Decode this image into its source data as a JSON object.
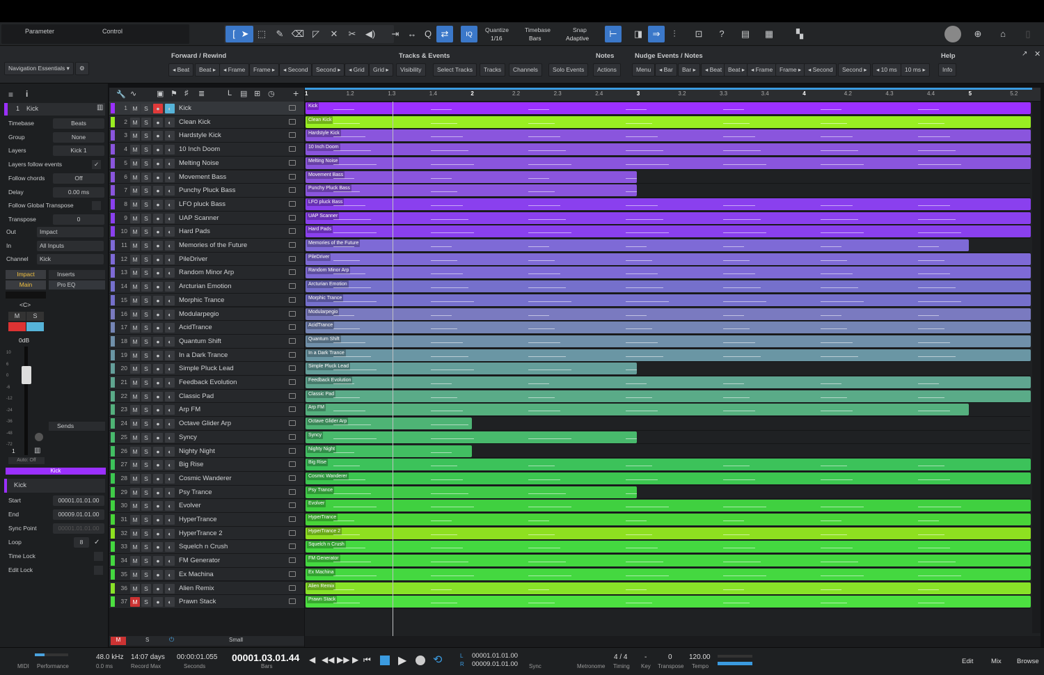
{
  "toolbar": {
    "parameter": "Parameter",
    "control": "Control",
    "quantize_label": "Quantize",
    "quantize_value": "1/16",
    "timebase_label": "Timebase",
    "timebase_value": "Bars",
    "snap_label": "Snap",
    "snap_value": "Adaptive",
    "iq": "IQ"
  },
  "macro": {
    "nav_essentials": "Navigation Essentials",
    "groups": [
      {
        "title": "Forward / Rewind",
        "buttons": [
          "◂ Beat",
          "Beat ▸",
          "◂ Frame",
          "Frame ▸",
          "◂ Second",
          "Second ▸",
          "◂ Grid",
          "Grid ▸"
        ]
      },
      {
        "title": "Tracks & Events",
        "buttons": [
          "Visibility",
          "Select Tracks",
          "Tracks",
          "Channels",
          "Solo Events"
        ]
      },
      {
        "title": "Notes",
        "buttons": [
          "Actions"
        ]
      },
      {
        "title": "Nudge Events / Notes",
        "buttons": [
          "Menu",
          "◂ Bar",
          "Bar ▸",
          "◂ Beat",
          "Beat ▸",
          "◂ Frame",
          "Frame ▸",
          "◂ Second",
          "Second ▸",
          "◂ 10 ms",
          "10 ms ▸"
        ]
      },
      {
        "title": "Help",
        "buttons": [
          "Info"
        ]
      }
    ]
  },
  "inspector": {
    "track_number": "1",
    "track_name": "Kick",
    "rows": [
      {
        "label": "Timebase",
        "value": "Beats"
      },
      {
        "label": "Group",
        "value": "None"
      },
      {
        "label": "Layers",
        "value": "Kick 1"
      },
      {
        "label": "Layers follow events",
        "value": ""
      },
      {
        "label": "Follow chords",
        "value": "Off"
      },
      {
        "label": "Delay",
        "value": "0.00 ms"
      },
      {
        "label": "Follow Global Transpose",
        "value": ""
      },
      {
        "label": "Transpose",
        "value": "0"
      }
    ],
    "io": [
      {
        "label": "Out",
        "value": "Impact"
      },
      {
        "label": "In",
        "value": "All Inputs"
      },
      {
        "label": "Channel",
        "value": "Kick"
      }
    ],
    "channel": {
      "impact": "Impact",
      "main": "Main",
      "inserts": "Inserts",
      "pro_eq": "Pro EQ",
      "pan": "<C>",
      "mute": "M",
      "solo": "S",
      "volume": "0dB",
      "sends": "Sends",
      "auto": "Auto: Off",
      "channel_name": "Kick",
      "scale": [
        "10",
        "6",
        "0",
        "-6",
        "-12",
        "-24",
        "-36",
        "-48",
        "-72"
      ]
    },
    "event": {
      "name": "Kick",
      "start_label": "Start",
      "start": "00001.01.01.00",
      "end_label": "End",
      "end": "00009.01.01.00",
      "sync_label": "Sync Point",
      "sync": "00001.01.01.00",
      "loop_label": "Loop",
      "loop": "8",
      "timelock": "Time Lock",
      "editlock": "Edit Lock"
    }
  },
  "ruler": [
    "1",
    "1.2",
    "1.3",
    "1.4",
    "2",
    "2.2",
    "2.3",
    "2.4",
    "3",
    "3.2",
    "3.3",
    "3.4",
    "4",
    "4.2",
    "4.3",
    "4.4",
    "5",
    "5.2"
  ],
  "tracks": [
    {
      "n": "1",
      "name": "Kick",
      "color": "#9b30ff",
      "end": 1.0,
      "selected": true
    },
    {
      "n": "2",
      "name": "Clean Kick",
      "color": "#99ee22",
      "end": 1.0
    },
    {
      "n": "3",
      "name": "Hardstyle Kick",
      "color": "#8a55dd",
      "end": 1.0
    },
    {
      "n": "4",
      "name": "10 Inch Doom",
      "color": "#8a55dd",
      "end": 1.0
    },
    {
      "n": "5",
      "name": "Melting Noise",
      "color": "#8a55dd",
      "end": 1.0
    },
    {
      "n": "6",
      "name": "Movement Bass",
      "color": "#8a55dd",
      "end": 0.457
    },
    {
      "n": "7",
      "name": "Punchy Pluck Bass",
      "color": "#8a55dd",
      "end": 0.457
    },
    {
      "n": "8",
      "name": "LFO pluck Bass",
      "color": "#8a40ee",
      "end": 1.0
    },
    {
      "n": "9",
      "name": "UAP Scanner",
      "color": "#8a40ee",
      "end": 1.0
    },
    {
      "n": "10",
      "name": "Hard Pads",
      "color": "#8a40ee",
      "end": 1.0
    },
    {
      "n": "11",
      "name": "Memories of the Future",
      "color": "#7e6ad6",
      "end": 0.915
    },
    {
      "n": "12",
      "name": "PileDriver",
      "color": "#7e6ad6",
      "end": 1.0
    },
    {
      "n": "13",
      "name": "Random Minor Arp",
      "color": "#7e6ad6",
      "end": 1.0
    },
    {
      "n": "14",
      "name": "Arcturian Emotion",
      "color": "#7570cc",
      "end": 1.0
    },
    {
      "n": "15",
      "name": "Morphic Trance",
      "color": "#7570cc",
      "end": 1.0
    },
    {
      "n": "16",
      "name": "Modularpegio",
      "color": "#7a7ac0",
      "end": 1.0
    },
    {
      "n": "17",
      "name": "AcidTrance",
      "color": "#7585b5",
      "end": 1.0
    },
    {
      "n": "18",
      "name": "Quantum Shift",
      "color": "#7090aa",
      "end": 1.0
    },
    {
      "n": "19",
      "name": "In a Dark Trance",
      "color": "#6a96a4",
      "end": 1.0
    },
    {
      "n": "20",
      "name": "Simple Pluck Lead",
      "color": "#649e9a",
      "end": 0.457
    },
    {
      "n": "21",
      "name": "Feedback Evolution",
      "color": "#5fa590",
      "end": 1.0
    },
    {
      "n": "22",
      "name": "Classic Pad",
      "color": "#5aab88",
      "end": 1.0
    },
    {
      "n": "23",
      "name": "Arp FM",
      "color": "#55b07e",
      "end": 0.915
    },
    {
      "n": "24",
      "name": "Octave Glider Arp",
      "color": "#4eb475",
      "end": 0.229
    },
    {
      "n": "25",
      "name": "Syncy",
      "color": "#48b96c",
      "end": 0.457
    },
    {
      "n": "26",
      "name": "Nighty Night",
      "color": "#42be62",
      "end": 0.229
    },
    {
      "n": "27",
      "name": "Big Rise",
      "color": "#3cc25a",
      "end": 1.0
    },
    {
      "n": "28",
      "name": "Cosmic Wanderer",
      "color": "#3cc650",
      "end": 1.0
    },
    {
      "n": "29",
      "name": "Psy Trance",
      "color": "#40ca48",
      "end": 0.457
    },
    {
      "n": "30",
      "name": "Evolver",
      "color": "#40d040",
      "end": 1.0
    },
    {
      "n": "31",
      "name": "HyperTrance",
      "color": "#48d438",
      "end": 1.0
    },
    {
      "n": "32",
      "name": "HyperTrance 2",
      "color": "#8ee020",
      "end": 1.0
    },
    {
      "n": "33",
      "name": "Squelch n Crush",
      "color": "#44d840",
      "end": 1.0
    },
    {
      "n": "34",
      "name": "FM Generator",
      "color": "#44d840",
      "end": 1.0
    },
    {
      "n": "35",
      "name": "Ex Machina",
      "color": "#44d840",
      "end": 1.0
    },
    {
      "n": "36",
      "name": "Alien Remix",
      "color": "#88e228",
      "end": 1.0
    },
    {
      "n": "37",
      "name": "Prawn Stack",
      "color": "#4ce040",
      "end": 1.0,
      "mute_on": true
    }
  ],
  "tracklist_footer": {
    "m": "M",
    "s": "S",
    "size": "Small"
  },
  "transport": {
    "midi": "MIDI",
    "performance": "Performance",
    "sample_rate": "48.0 kHz",
    "latency": "0.0 ms",
    "record_days": "14:07 days",
    "record_max": "Record Max",
    "seconds_value": "00:00:01.055",
    "seconds_label": "Seconds",
    "bars_value": "00001.03.01.44",
    "bars_label": "Bars",
    "loop_start": "00001.01.01.00",
    "loop_end": "00009.01.01.00",
    "L": "L",
    "R": "R",
    "sync": "Sync",
    "metronome": "Metronome",
    "timing_value": "4 / 4",
    "timing": "Timing",
    "key_value": "-",
    "key": "Key",
    "transpose_value": "0",
    "transpose": "Transpose",
    "tempo_value": "120.00",
    "tempo": "Tempo",
    "edit": "Edit",
    "mix": "Mix",
    "browse": "Browse"
  },
  "colors": {
    "accent": "#3b78c9",
    "kick": "#9b30ff",
    "record": "#e03a3a"
  }
}
